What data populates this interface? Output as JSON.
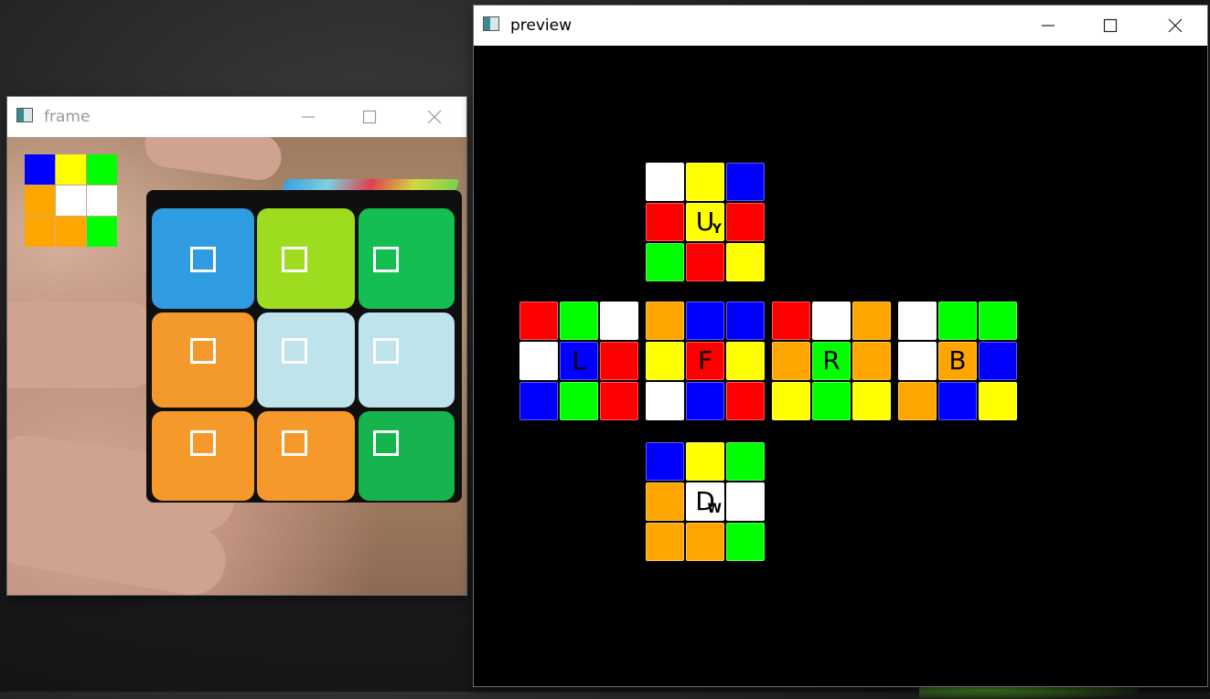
{
  "colors": {
    "red": "#ff0000",
    "yellow": "#ffff00",
    "blue": "#0000ff",
    "green": "#00ff00",
    "orange": "#ffa500",
    "white": "#ffffff",
    "window_bg": "#ffffff",
    "preview_bg": "#000000"
  },
  "frame_window": {
    "title": "frame",
    "icon": "app-window-icon",
    "controls": [
      "minimize-icon",
      "maximize-icon",
      "close-icon"
    ],
    "detected_stickers": [
      "blue",
      "yellow",
      "green",
      "orange",
      "white",
      "white",
      "orange",
      "orange",
      "green"
    ],
    "camera_stickers": [
      "#2f9be0",
      "#9ddc1e",
      "#14be50",
      "#f49a2c",
      "#bfe3ea",
      "#bfe3ea",
      "#f59a2a",
      "#f59a2a",
      "#16b44e"
    ]
  },
  "preview_window": {
    "title": "preview",
    "icon": "app-window-icon",
    "controls": [
      "minimize-icon",
      "maximize-icon",
      "close-icon"
    ],
    "faces": {
      "U": {
        "label": "U",
        "sub": "Y",
        "cells": [
          "white",
          "yellow",
          "blue",
          "red",
          "yellow",
          "red",
          "green",
          "red",
          "yellow"
        ]
      },
      "L": {
        "label": "L",
        "sub": "",
        "cells": [
          "red",
          "green",
          "white",
          "white",
          "blue",
          "red",
          "blue",
          "green",
          "red"
        ]
      },
      "F": {
        "label": "F",
        "sub": "",
        "cells": [
          "orange",
          "blue",
          "blue",
          "yellow",
          "red",
          "yellow",
          "white",
          "blue",
          "red"
        ]
      },
      "R": {
        "label": "R",
        "sub": "",
        "cells": [
          "red",
          "white",
          "orange",
          "orange",
          "green",
          "orange",
          "yellow",
          "green",
          "yellow"
        ]
      },
      "B": {
        "label": "B",
        "sub": "",
        "cells": [
          "white",
          "green",
          "green",
          "white",
          "orange",
          "blue",
          "orange",
          "blue",
          "yellow"
        ]
      },
      "D": {
        "label": "D",
        "sub": "W",
        "cells": [
          "blue",
          "yellow",
          "green",
          "orange",
          "white",
          "white",
          "orange",
          "orange",
          "green"
        ]
      }
    }
  }
}
